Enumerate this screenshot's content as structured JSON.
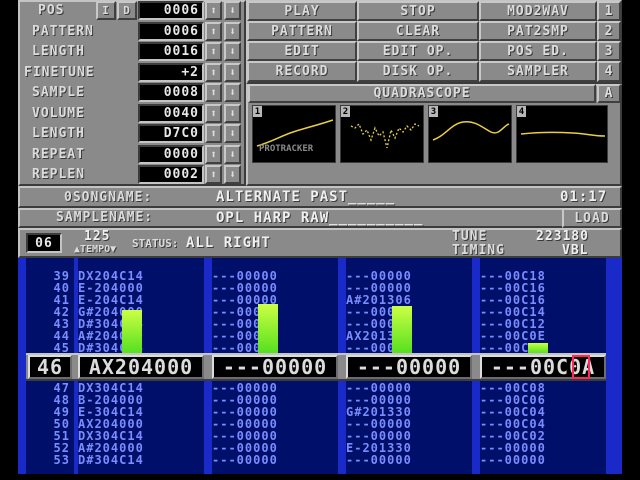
{
  "controls": {
    "pos": {
      "label": "POS",
      "value": "0006"
    },
    "insert_label": "I",
    "delete_label": "D",
    "pattern": {
      "label": "PATTERN",
      "value": "0006"
    },
    "length": {
      "label": "LENGTH",
      "value": "0016"
    },
    "finetune": {
      "label": "FINETUNE",
      "value": "+2"
    },
    "sample": {
      "label": "SAMPLE",
      "value": "0008"
    },
    "volume": {
      "label": "VOLUME",
      "value": "0040"
    },
    "sample_length": {
      "label": "LENGTH",
      "value": "D7C0"
    },
    "repeat": {
      "label": "REPEAT",
      "value": "0000"
    },
    "replen": {
      "label": "REPLEN",
      "value": "0002"
    },
    "up_arrow": "⬆",
    "down_arrow": "⬇"
  },
  "menu": {
    "play": "PLAY",
    "stop": "STOP",
    "mod2wav": "MOD2WAV",
    "pattern": "PATTERN",
    "clear": "CLEAR",
    "pat2smp": "PAT2SMP",
    "edit": "EDIT",
    "edit_op": "EDIT OP.",
    "pos_ed": "POS ED.",
    "record": "RECORD",
    "disk_op": "DISK OP.",
    "sampler": "SAMPLER",
    "nums": [
      "1",
      "2",
      "3",
      "4"
    ]
  },
  "scope": {
    "title": "QUADRASCOPE",
    "toggle": "A",
    "logo": "PROTRACKER",
    "channels": [
      "1",
      "2",
      "3",
      "4"
    ],
    "color": "#e8d040"
  },
  "info": {
    "songname_label": "0SONGNAME:",
    "songname": "ALTERNATE PAST_____",
    "time": "01:17",
    "samplename_label": "SAMPLENAME:",
    "samplename": "OPL HARP RAW__________",
    "load_label": "LOAD"
  },
  "status": {
    "octave": "06",
    "tempo_value": "125",
    "tempo_label": "▲TEMPO▼",
    "status_label": "STATUS:",
    "status_text": "ALL RIGHT",
    "tune_label": "TUNE",
    "tune_value": "223180",
    "timing_label": "TIMING",
    "timing_value": "VBL"
  },
  "pattern": {
    "cursor_row": "46",
    "cursor_cells": [
      "AX204000",
      "---00000",
      "---00000",
      "---00C0A"
    ],
    "rows": [
      {
        "n": "39",
        "c": [
          "DX204C14",
          "---00000",
          "---00000",
          "---00C18"
        ]
      },
      {
        "n": "40",
        "c": [
          "E-204000",
          "---00000",
          "---00000",
          "---00C16"
        ]
      },
      {
        "n": "41",
        "c": [
          "E-204C14",
          "---00000",
          "A#201306",
          "---00C16"
        ]
      },
      {
        "n": "42",
        "c": [
          "G#204000",
          "---00000",
          "---00000",
          "---00C14"
        ]
      },
      {
        "n": "43",
        "c": [
          "D#304C14",
          "---00000",
          "---00000",
          "---00C12"
        ]
      },
      {
        "n": "44",
        "c": [
          "A#204000",
          "---00000",
          "AX201310",
          "---00C0E"
        ]
      },
      {
        "n": "45",
        "c": [
          "D#304C14",
          "---00000",
          "---00000",
          "---00C0C"
        ]
      },
      {
        "n": "47",
        "c": [
          "DX304C14",
          "---00000",
          "---00000",
          "---00C08"
        ]
      },
      {
        "n": "48",
        "c": [
          "B-204000",
          "---00000",
          "---00000",
          "---00C06"
        ]
      },
      {
        "n": "49",
        "c": [
          "E-304C14",
          "---00000",
          "G#201330",
          "---00C04"
        ]
      },
      {
        "n": "50",
        "c": [
          "AX204000",
          "---00000",
          "---00000",
          "---00C04"
        ]
      },
      {
        "n": "51",
        "c": [
          "DX304C14",
          "---00000",
          "---00000",
          "---00C02"
        ]
      },
      {
        "n": "52",
        "c": [
          "A#204000",
          "---00000",
          "E-201330",
          "---00000"
        ]
      },
      {
        "n": "53",
        "c": [
          "D#304C14",
          "---00000",
          "---00000",
          "---00000"
        ]
      }
    ],
    "vu_levels": [
      0.72,
      0.82,
      0.78,
      0.17
    ]
  }
}
